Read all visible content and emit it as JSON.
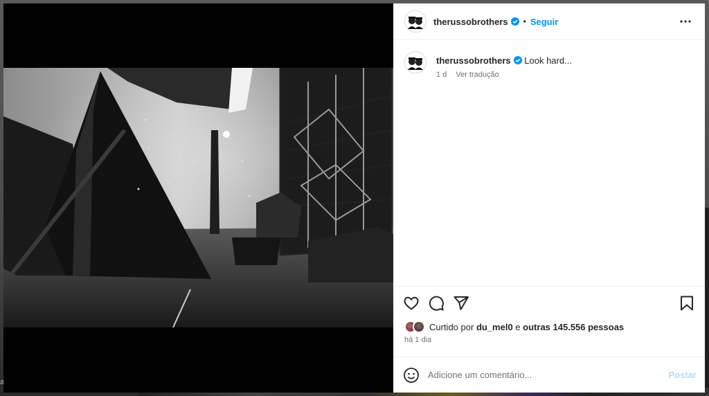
{
  "post": {
    "username": "therussobrothers",
    "follow_label": "Seguir",
    "separator": "•",
    "caption": "Look hard...",
    "age": "1 d",
    "translate_label": "Ver tradução",
    "liked_prefix": "Curtido por",
    "liked_user": "du_mel0",
    "liked_conjunction": "e",
    "liked_others": "outras 145.556 pessoas",
    "time_ago": "há 1 dia",
    "comment_placeholder": "Adicione um comentário...",
    "post_button": "Postar"
  },
  "backdrop": {
    "edge_letter": "a"
  },
  "icons": {
    "more": "more-options-icon",
    "like": "heart-icon",
    "comment": "comment-icon",
    "share": "send-icon",
    "save": "bookmark-icon",
    "emoji": "emoji-icon",
    "verified": "verified-badge-icon"
  },
  "colors": {
    "accent": "#0095f6",
    "post_disabled": "#b3dbff",
    "verified": "#0095f6",
    "secondary_text": "#737373"
  }
}
